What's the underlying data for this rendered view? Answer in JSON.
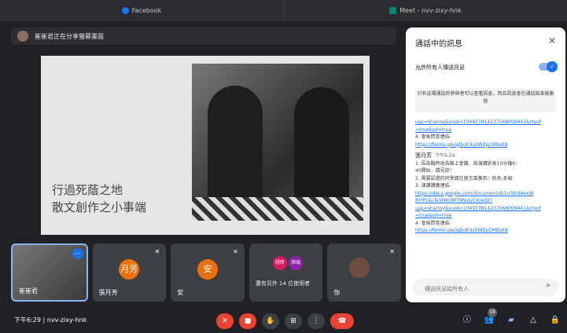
{
  "tabs": [
    "Facebook",
    "Meet - nvv-zixy-hnk"
  ],
  "share_banner": "崔崔君正在分享螢幕畫面",
  "slide": {
    "title_line1": "行過死蔭之地",
    "title_line2": "散文創作之小事端"
  },
  "tiles": [
    {
      "name": "崔崔君",
      "type": "self"
    },
    {
      "name": "張月芳",
      "avatar": "月芳"
    },
    {
      "name": "安",
      "avatar": "安"
    },
    {
      "mini": [
        "翊倖",
        "添瑞"
      ],
      "others": "還有另外 14 位使用者"
    },
    {
      "name": "你"
    }
  ],
  "chat": {
    "header": "通話中的訊息",
    "allow_label": "允許所有人傳送訊息",
    "notice": "只有這場通話的參與者可以查看訊息，而且訊息會在通話結束後刪除",
    "lines_top": [
      {
        "t": "usp=sharing&ouid=104977814237568009441&rtpof",
        "link": true
      },
      {
        "t": "=true&sd=true",
        "link": true
      },
      {
        "t": "4.   會後問卷連結-",
        "link": false
      },
      {
        "t": "https://forms.gle/gJ5oE9sXWZpCMBsK8",
        "link": true
      }
    ],
    "sender": "張月芳",
    "time": "下午6:24",
    "lines_bottom": [
      {
        "t": "1.   因為臨時改為線上會議，故演講延後10分鐘6：",
        "link": false
      },
      {
        "t": "40開始，請見諒！",
        "link": false
      },
      {
        "t": "2.   需要認證的同學請在留言區簽到：姓名-系級",
        "link": false
      },
      {
        "t": "3.   演講講義連結-",
        "link": false
      },
      {
        "t": "https://docs.google.com/document/d/1uTsh4AexW",
        "link": true
      },
      {
        "t": "BIYPLkuTe5NKLMiT9NvJyCX/edit?",
        "link": true
      },
      {
        "t": "usp=sharing&ouid=104977814237568009441&rtpof",
        "link": true
      },
      {
        "t": "=true&sd=true",
        "link": true
      },
      {
        "t": "4.   會後問卷連結-",
        "link": false
      },
      {
        "t": "https://forms.gle/gJ5oE9sXWZpCMBsK8",
        "link": true
      }
    ],
    "input_placeholder": "傳送訊息給所有人"
  },
  "bottom": {
    "time": "下午6:29",
    "code": "nvv-zixy-hnk",
    "participants_badge": "19"
  }
}
